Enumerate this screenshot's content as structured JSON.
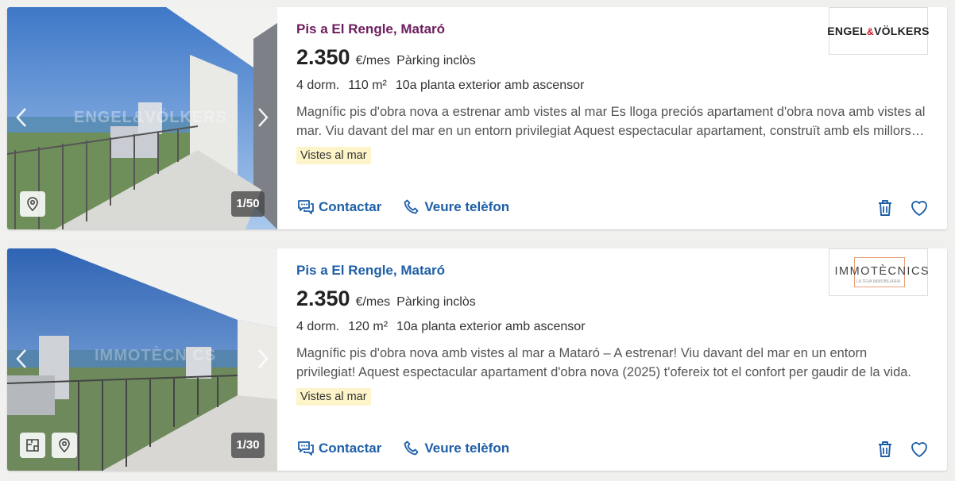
{
  "listings": [
    {
      "title": "Pis a El Rengle, Mataró",
      "price": "2.350",
      "price_unit": "€/mes",
      "parking": "Pàrking inclòs",
      "details": [
        "4 dorm.",
        "110 m²",
        "10a planta exterior amb ascensor"
      ],
      "description": "Magnífic pis d'obra nova a estrenar amb vistes al mar Es lloga preciós apartament d'obra nova amb vistes al mar. Viu davant del mar en un entorn privilegiat Aquest espectacular apartament, construït amb els millors materials i acabats de primera qualitat.",
      "tag": "Vistes al mar",
      "photo_counter": "1/50",
      "watermark": "ENGEL&VÖLKERS",
      "agency_logo": {
        "left": "ENGEL",
        "amp": "&",
        "right": "VÖLKERS"
      },
      "contact_label": "Contactar",
      "phone_label": "Veure telèfon"
    },
    {
      "title": "Pis a El Rengle, Mataró",
      "price": "2.350",
      "price_unit": "€/mes",
      "parking": "Pàrking inclòs",
      "details": [
        "4 dorm.",
        "120 m²",
        "10a planta exterior amb ascensor"
      ],
      "description": "Magnífic pis d'obra nova amb vistes al mar a Mataró – A estrenar! Viu davant del mar en un entorn privilegiat! Aquest espectacular apartament d'obra nova (2025) t'ofereix tot el confort per gaudir de la vida.",
      "tag": "Vistes al mar",
      "photo_counter": "1/30",
      "watermark": "IMMOTÈCN CS",
      "agency_logo": {
        "name": "IMMOTÈCNICS",
        "sub": "LA TEVA IMMOBILIÀRIA"
      },
      "contact_label": "Contactar",
      "phone_label": "Veure telèfon"
    }
  ],
  "colors": {
    "link_blue": "#1e5fa7",
    "visited_title": "#6d1c5d",
    "tag_bg": "#fdf4c9",
    "brand_red": "#c6121f"
  },
  "icons": [
    "chevron-left-icon",
    "chevron-right-icon",
    "map-pin-icon",
    "floorplan-icon",
    "chat-icon",
    "phone-icon",
    "trash-icon",
    "heart-icon"
  ]
}
